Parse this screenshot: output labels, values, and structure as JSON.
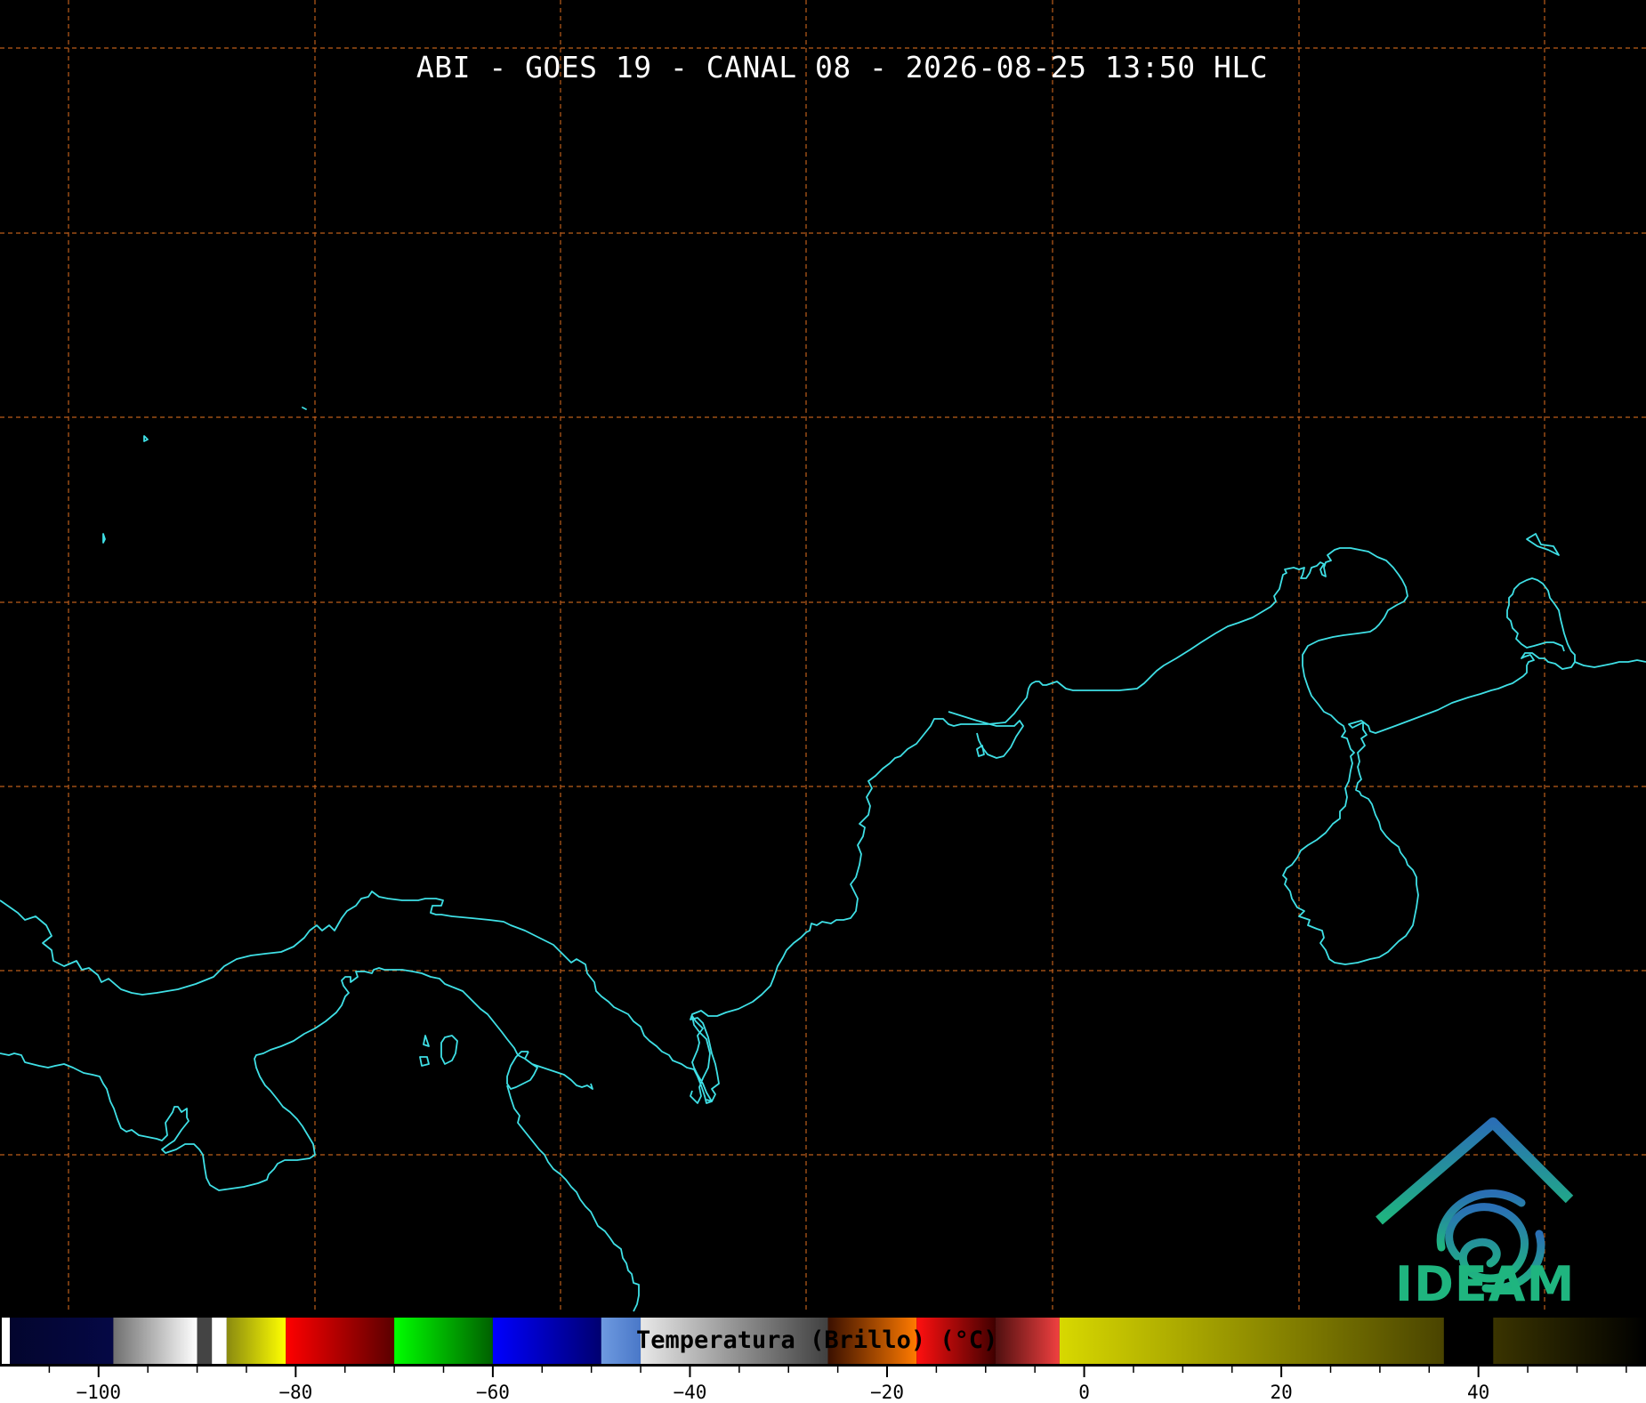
{
  "title": "ABI - GOES 19 - CANAL 08 - 2026-08-25 13:50 HLC",
  "colorbar": {
    "label": "Temperatura (Brillo) (°C)",
    "ticks": [
      {
        "value": -100,
        "label": "−100"
      },
      {
        "value": -80,
        "label": "−80"
      },
      {
        "value": -60,
        "label": "−60"
      },
      {
        "value": -40,
        "label": "−40"
      },
      {
        "value": -20,
        "label": "−20"
      },
      {
        "value": 0,
        "label": "0"
      },
      {
        "value": 20,
        "label": "20"
      },
      {
        "value": 40,
        "label": "40"
      }
    ],
    "range": [
      -110,
      57
    ]
  },
  "logo": {
    "text": "IDEAM"
  },
  "colors": {
    "background": "#000000",
    "coastline": "#3fe0e6",
    "gridlines": "#d2691e",
    "logo_green": "#1fb57f",
    "logo_blue": "#2a7fb8"
  },
  "map": {
    "gridlines": "dashed",
    "coastlines": true
  }
}
